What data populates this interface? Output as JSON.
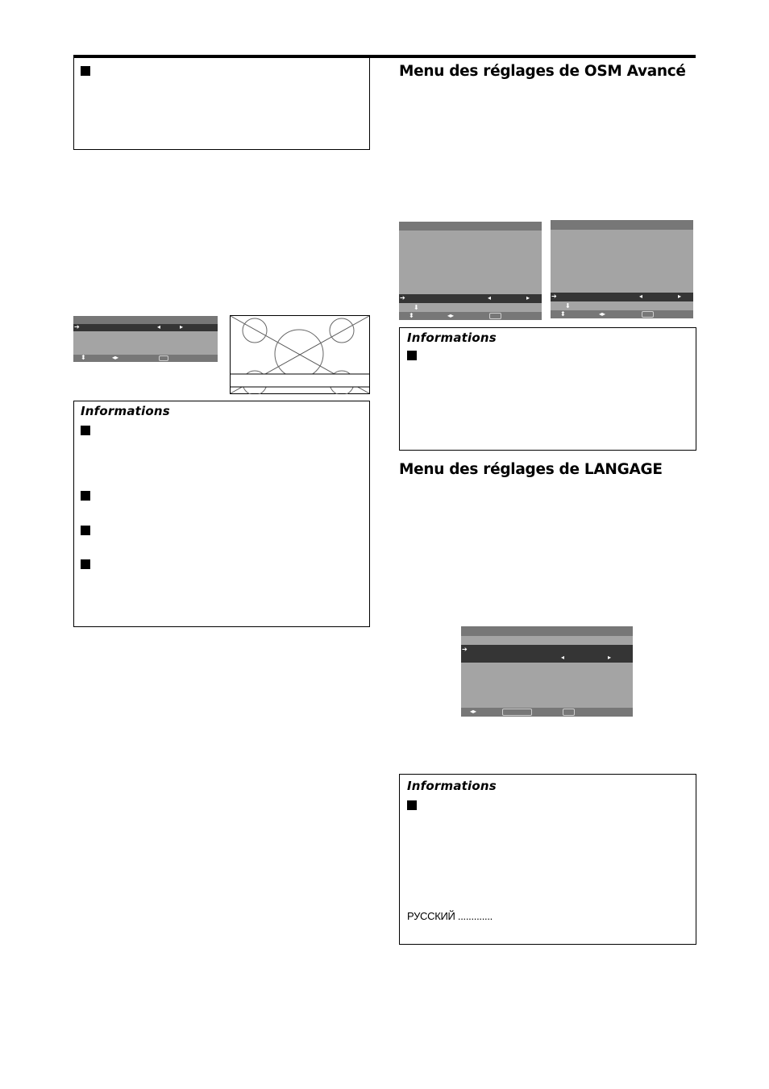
{
  "page": {
    "top_rule": true
  },
  "left_column": {
    "note_box": {
      "bullet_count": 1
    },
    "osd_menu": {
      "selected_row_icons": {
        "pointer": "right-arrow-icon",
        "left": "left-triangle-icon",
        "right": "right-triangle-icon"
      },
      "footer_icons": [
        "up-down-icon",
        "left-right-icon",
        "button-outline-icon"
      ]
    },
    "screen_diagram": {
      "description": "test pattern with circles and diagonals, letterbox band"
    },
    "info_box": {
      "title": "Informations",
      "bullet_count": 4
    }
  },
  "right_column": {
    "section1": {
      "heading": "Menu des réglages de OSM Avancé",
      "osd_menus": [
        {
          "footer_icons": [
            "up-down-icon",
            "left-right-icon",
            "button-outline-icon"
          ]
        },
        {
          "footer_icons": [
            "up-down-icon",
            "left-right-icon",
            "button-outline-icon"
          ]
        }
      ],
      "info_box": {
        "title": "Informations",
        "bullet_count": 1
      }
    },
    "section2": {
      "heading": "Menu des réglages de LANGAGE",
      "osd_menu": {
        "footer_icons": [
          "left-right-icon",
          "wide-button-outline-icon",
          "button-outline-icon"
        ]
      },
      "info_box": {
        "title": "Informations",
        "bullet_count": 1,
        "language_line": "РУССКИЙ ............."
      }
    }
  },
  "colors": {
    "osd_body": "#a4a4a4",
    "osd_bar": "#777777",
    "osd_selected": "#353535"
  }
}
